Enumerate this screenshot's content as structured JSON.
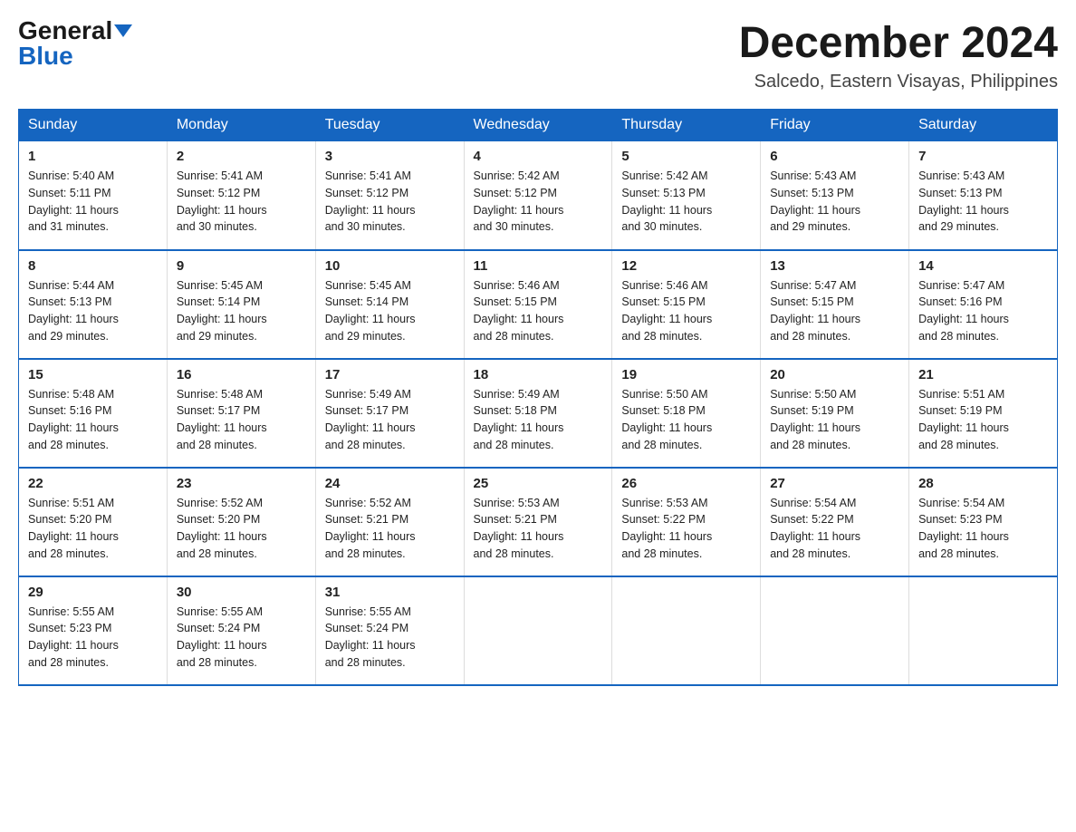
{
  "header": {
    "logo_general": "General",
    "logo_blue": "Blue",
    "month_title": "December 2024",
    "location": "Salcedo, Eastern Visayas, Philippines"
  },
  "days_of_week": [
    "Sunday",
    "Monday",
    "Tuesday",
    "Wednesday",
    "Thursday",
    "Friday",
    "Saturday"
  ],
  "weeks": [
    [
      {
        "num": "1",
        "sunrise": "5:40 AM",
        "sunset": "5:11 PM",
        "daylight": "11 hours and 31 minutes."
      },
      {
        "num": "2",
        "sunrise": "5:41 AM",
        "sunset": "5:12 PM",
        "daylight": "11 hours and 30 minutes."
      },
      {
        "num": "3",
        "sunrise": "5:41 AM",
        "sunset": "5:12 PM",
        "daylight": "11 hours and 30 minutes."
      },
      {
        "num": "4",
        "sunrise": "5:42 AM",
        "sunset": "5:12 PM",
        "daylight": "11 hours and 30 minutes."
      },
      {
        "num": "5",
        "sunrise": "5:42 AM",
        "sunset": "5:13 PM",
        "daylight": "11 hours and 30 minutes."
      },
      {
        "num": "6",
        "sunrise": "5:43 AM",
        "sunset": "5:13 PM",
        "daylight": "11 hours and 29 minutes."
      },
      {
        "num": "7",
        "sunrise": "5:43 AM",
        "sunset": "5:13 PM",
        "daylight": "11 hours and 29 minutes."
      }
    ],
    [
      {
        "num": "8",
        "sunrise": "5:44 AM",
        "sunset": "5:13 PM",
        "daylight": "11 hours and 29 minutes."
      },
      {
        "num": "9",
        "sunrise": "5:45 AM",
        "sunset": "5:14 PM",
        "daylight": "11 hours and 29 minutes."
      },
      {
        "num": "10",
        "sunrise": "5:45 AM",
        "sunset": "5:14 PM",
        "daylight": "11 hours and 29 minutes."
      },
      {
        "num": "11",
        "sunrise": "5:46 AM",
        "sunset": "5:15 PM",
        "daylight": "11 hours and 28 minutes."
      },
      {
        "num": "12",
        "sunrise": "5:46 AM",
        "sunset": "5:15 PM",
        "daylight": "11 hours and 28 minutes."
      },
      {
        "num": "13",
        "sunrise": "5:47 AM",
        "sunset": "5:15 PM",
        "daylight": "11 hours and 28 minutes."
      },
      {
        "num": "14",
        "sunrise": "5:47 AM",
        "sunset": "5:16 PM",
        "daylight": "11 hours and 28 minutes."
      }
    ],
    [
      {
        "num": "15",
        "sunrise": "5:48 AM",
        "sunset": "5:16 PM",
        "daylight": "11 hours and 28 minutes."
      },
      {
        "num": "16",
        "sunrise": "5:48 AM",
        "sunset": "5:17 PM",
        "daylight": "11 hours and 28 minutes."
      },
      {
        "num": "17",
        "sunrise": "5:49 AM",
        "sunset": "5:17 PM",
        "daylight": "11 hours and 28 minutes."
      },
      {
        "num": "18",
        "sunrise": "5:49 AM",
        "sunset": "5:18 PM",
        "daylight": "11 hours and 28 minutes."
      },
      {
        "num": "19",
        "sunrise": "5:50 AM",
        "sunset": "5:18 PM",
        "daylight": "11 hours and 28 minutes."
      },
      {
        "num": "20",
        "sunrise": "5:50 AM",
        "sunset": "5:19 PM",
        "daylight": "11 hours and 28 minutes."
      },
      {
        "num": "21",
        "sunrise": "5:51 AM",
        "sunset": "5:19 PM",
        "daylight": "11 hours and 28 minutes."
      }
    ],
    [
      {
        "num": "22",
        "sunrise": "5:51 AM",
        "sunset": "5:20 PM",
        "daylight": "11 hours and 28 minutes."
      },
      {
        "num": "23",
        "sunrise": "5:52 AM",
        "sunset": "5:20 PM",
        "daylight": "11 hours and 28 minutes."
      },
      {
        "num": "24",
        "sunrise": "5:52 AM",
        "sunset": "5:21 PM",
        "daylight": "11 hours and 28 minutes."
      },
      {
        "num": "25",
        "sunrise": "5:53 AM",
        "sunset": "5:21 PM",
        "daylight": "11 hours and 28 minutes."
      },
      {
        "num": "26",
        "sunrise": "5:53 AM",
        "sunset": "5:22 PM",
        "daylight": "11 hours and 28 minutes."
      },
      {
        "num": "27",
        "sunrise": "5:54 AM",
        "sunset": "5:22 PM",
        "daylight": "11 hours and 28 minutes."
      },
      {
        "num": "28",
        "sunrise": "5:54 AM",
        "sunset": "5:23 PM",
        "daylight": "11 hours and 28 minutes."
      }
    ],
    [
      {
        "num": "29",
        "sunrise": "5:55 AM",
        "sunset": "5:23 PM",
        "daylight": "11 hours and 28 minutes."
      },
      {
        "num": "30",
        "sunrise": "5:55 AM",
        "sunset": "5:24 PM",
        "daylight": "11 hours and 28 minutes."
      },
      {
        "num": "31",
        "sunrise": "5:55 AM",
        "sunset": "5:24 PM",
        "daylight": "11 hours and 28 minutes."
      },
      null,
      null,
      null,
      null
    ]
  ],
  "labels": {
    "sunrise": "Sunrise:",
    "sunset": "Sunset:",
    "daylight": "Daylight:"
  }
}
